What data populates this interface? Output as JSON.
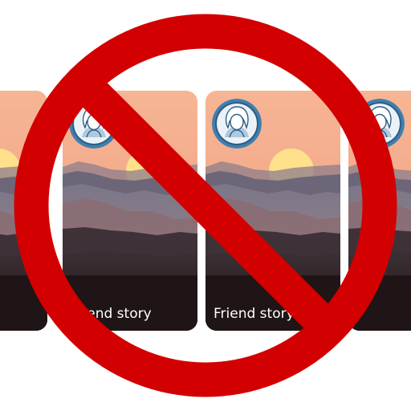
{
  "stories": [
    {
      "caption": ""
    },
    {
      "caption": "Friend story"
    },
    {
      "caption": "Friend story"
    },
    {
      "caption": ""
    }
  ],
  "icons": {
    "avatar": "user-avatar-icon",
    "prohibition": "prohibition-sign-icon"
  },
  "colors": {
    "sign_red": "#d20000",
    "sky_top": "#f6b494",
    "sky_bottom": "#f3a98a",
    "sun": "#ffe28a",
    "avatar_blue": "#3f7fb0"
  }
}
